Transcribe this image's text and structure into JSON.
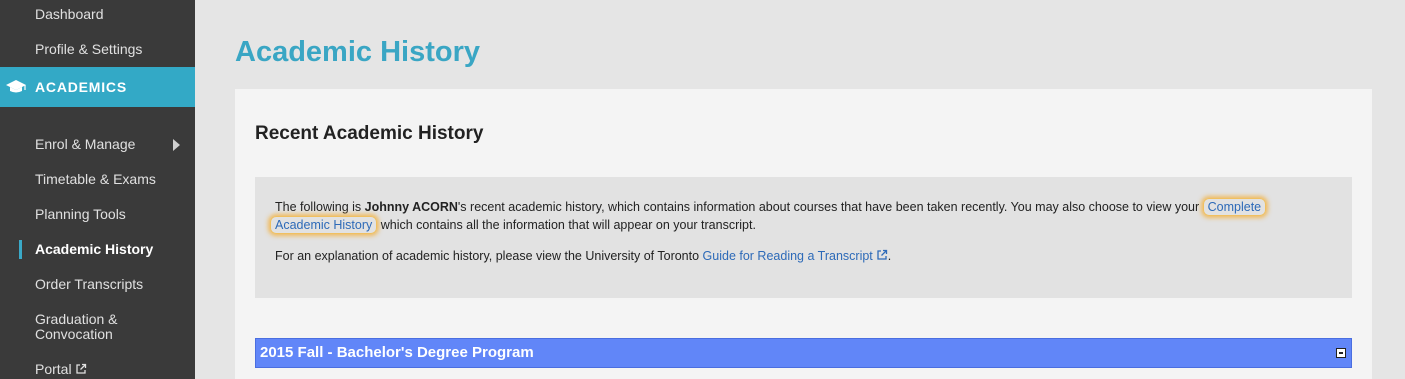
{
  "sidebar": {
    "items_top": [
      {
        "label": "Dashboard"
      },
      {
        "label": "Profile & Settings"
      }
    ],
    "section_label": "ACADEMICS",
    "section_icon": "graduation-cap-icon",
    "items": [
      {
        "label": "Enrol & Manage"
      },
      {
        "label": "Timetable & Exams"
      },
      {
        "label": "Planning Tools"
      },
      {
        "label": "Academic History"
      },
      {
        "label": "Order Transcripts"
      },
      {
        "label": "Graduation & Convocation"
      },
      {
        "label": "Portal"
      }
    ]
  },
  "main": {
    "page_title": "Academic History",
    "section_title": "Recent Academic History",
    "intro": {
      "part1": "The following is ",
      "student_name": "Johnny ACORN",
      "part2": "'s recent academic history, which contains information about courses that have been taken recently. You may also choose to view your ",
      "link1_line1": "Complete",
      "link1_line2": "Academic History",
      "part3": " which contains all the information that will appear on your transcript."
    },
    "explain": {
      "text": "For an explanation of academic history, please view the University of Toronto ",
      "link": "Guide for Reading a Transcript",
      "end": "."
    },
    "term_header": "2015 Fall - Bachelor's Degree Program"
  },
  "colors": {
    "accent": "#33a9c6",
    "term_bar": "#6186f8",
    "link": "#2d6ab8",
    "sidebar_bg": "#3a3a3a"
  }
}
